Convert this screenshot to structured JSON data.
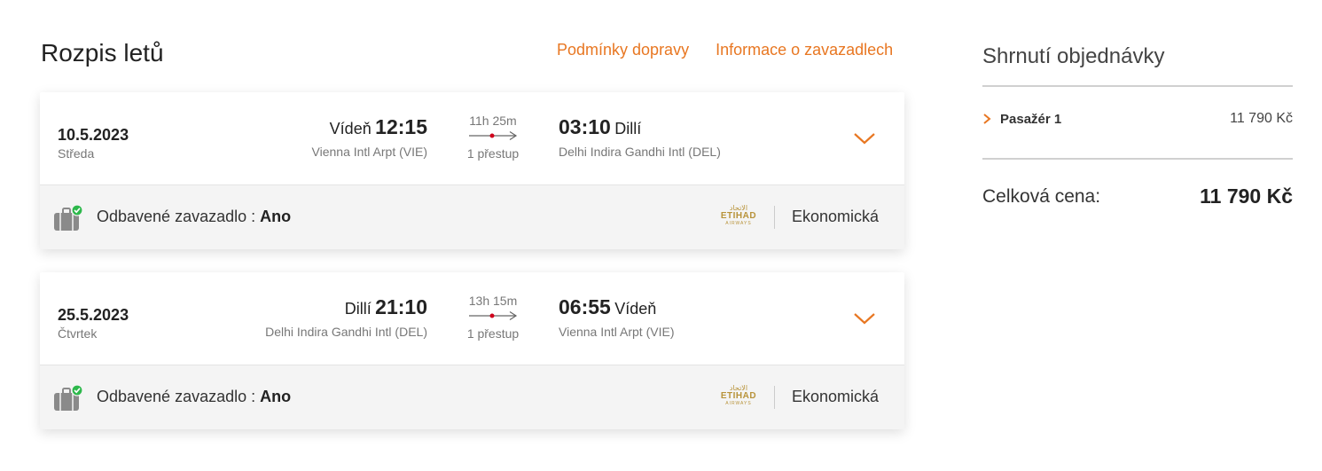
{
  "page_title": "Rozpis letů",
  "links": {
    "conditions": "Podmínky dopravy",
    "baggage_info": "Informace o zavazadlech"
  },
  "flights": [
    {
      "date": "10.5.2023",
      "day": "Středa",
      "departure": {
        "city": "Vídeň",
        "time": "12:15",
        "airport": "Vienna Intl Arpt (VIE)"
      },
      "duration": "11h 25m",
      "stops": "1 přestup",
      "arrival": {
        "time": "03:10",
        "city": "Dillí",
        "airport": "Delhi Indira Gandhi Intl (DEL)"
      },
      "baggage_label": "Odbavené zavazadlo :",
      "baggage_value": "Ano",
      "airline_brand": "ETIHAD",
      "airline_arabic": "الاتحاد",
      "airline_sub": "AIRWAYS",
      "cabin": "Ekonomická"
    },
    {
      "date": "25.5.2023",
      "day": "Čtvrtek",
      "departure": {
        "city": "Dillí",
        "time": "21:10",
        "airport": "Delhi Indira Gandhi Intl (DEL)"
      },
      "duration": "13h 15m",
      "stops": "1 přestup",
      "arrival": {
        "time": "06:55",
        "city": "Vídeň",
        "airport": "Vienna Intl Arpt (VIE)"
      },
      "baggage_label": "Odbavené zavazadlo :",
      "baggage_value": "Ano",
      "airline_brand": "ETIHAD",
      "airline_arabic": "الاتحاد",
      "airline_sub": "AIRWAYS",
      "cabin": "Ekonomická"
    }
  ],
  "summary": {
    "title": "Shrnutí objednávky",
    "passenger_label": "Pasažér 1",
    "passenger_price": "11 790 Kč",
    "total_label": "Celková cena:",
    "total_value": "11 790 Kč"
  },
  "colors": {
    "accent": "#e87722",
    "stop_dot": "#d0021b",
    "check": "#2db84b",
    "airline_gold": "#b8933a"
  },
  "icons": {
    "expand": "chevron-down-icon",
    "baggage": "suitcase-icon",
    "baggage_status": "check-circle-icon",
    "route": "route-arrow-icon",
    "passenger_expand": "chevron-right-icon"
  }
}
